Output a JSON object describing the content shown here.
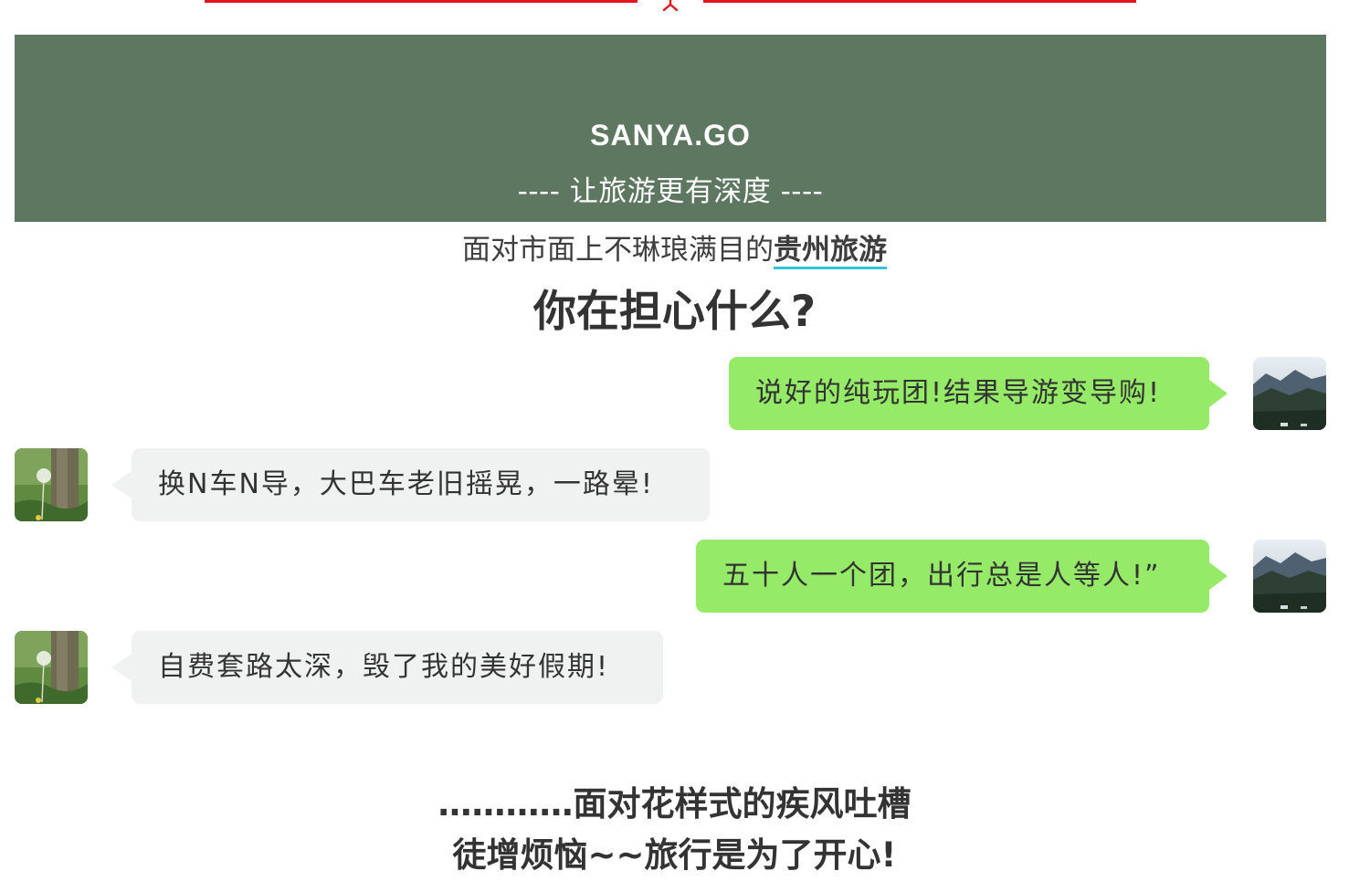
{
  "banner": {
    "brand": "SANYA.GO",
    "slogan": "---- 让旅游更有深度 ----",
    "background": "#5e7761"
  },
  "intro": {
    "prefix": "面对市面上不琳琅满目的",
    "highlight": "贵州旅游"
  },
  "headline": "你在担心什么?",
  "chat": {
    "messages": [
      {
        "side": "right",
        "text": "说好的纯玩团!结果导游变导购!",
        "avatar": "mountain-avatar"
      },
      {
        "side": "left",
        "text": "换N车N导，大巴车老旧摇晃，一路晕!",
        "avatar": "dandelion-avatar"
      },
      {
        "side": "right",
        "text": "五十人一个团，出行总是人等人!”",
        "avatar": "mountain-avatar"
      },
      {
        "side": "left",
        "text": "自费套路太深，毁了我的美好假期!",
        "avatar": "dandelion-avatar"
      }
    ]
  },
  "outro": {
    "line1": "…………面对花样式的疾风吐槽",
    "line2": "徒增烦恼~~旅行是为了开心!"
  },
  "colors": {
    "divider": "#e3141b",
    "bubble_right": "#95ea67",
    "bubble_left": "#f0f2f1",
    "highlight_underline": "#35c3d8"
  }
}
